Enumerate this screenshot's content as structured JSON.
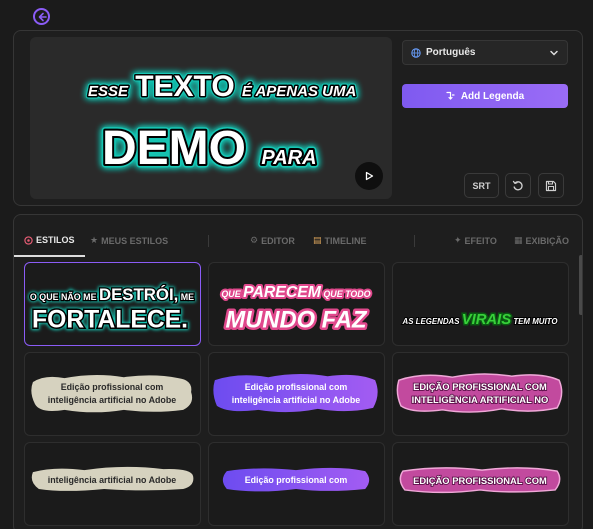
{
  "toolbar": {
    "back_icon": "arrow-left-circle-icon"
  },
  "preview": {
    "line1_pre": "ESSE",
    "line1_big": "TEXTO",
    "line1_post": "É APENAS UMA",
    "line2_big": "DEMO",
    "line2_post": "PARA",
    "play_icon": "play-icon"
  },
  "language": {
    "selected": "Português",
    "icon": "globe-icon"
  },
  "add_button": {
    "label": "Add Legenda"
  },
  "actions": {
    "srt_label": "SRT",
    "reset_icon": "reset-icon",
    "save_icon": "save-icon"
  },
  "tabs": {
    "estilos": "ESTILOS",
    "meus_estilos": "MEUS ESTILOS",
    "editor": "EDITOR",
    "timeline": "TIMELINE",
    "efeito": "EFEITO",
    "exibicao": "EXIBIÇÃO"
  },
  "styles": [
    {
      "a": "O QUE NÃO ME",
      "b": "DESTRÓI,",
      "c": "ME",
      "d": "FORTALECE."
    },
    {
      "a": "QUE",
      "b": "PARECEM",
      "c": "QUE TODO",
      "d": "MUNDO FAZ"
    },
    {
      "a": "AS LEGENDAS",
      "b": "VIRAIS",
      "c": "TEM MUITO"
    },
    {
      "l1": "Edição profissional com",
      "l2": "inteligência artificial no Adobe"
    },
    {
      "l1": "Edição profissional com",
      "l2": "inteligência artificial no Adobe"
    },
    {
      "l1": "EDIÇÃO PROFISSIONAL COM",
      "l2": "INTELIGÊNCIA ARTIFICIAL NO"
    },
    {
      "l1": "inteligência artificial no Adobe"
    },
    {
      "l1": "Edição profissional com"
    },
    {
      "l1": "EDIÇÃO PROFISSIONAL COM"
    }
  ],
  "colors": {
    "accent": "#8b5cf6",
    "teal_glow": "#19c6b4",
    "pink": "#e0488c",
    "green": "#38d13a"
  }
}
